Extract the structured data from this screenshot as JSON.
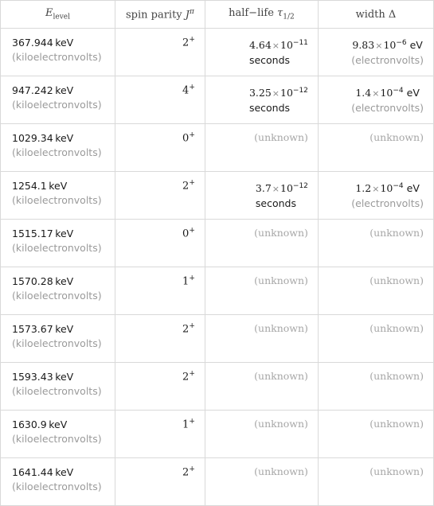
{
  "table": {
    "headers": {
      "energy": {
        "symbol": "E",
        "subscript": "level"
      },
      "spin": {
        "label": "spin parity ",
        "symbol": "J",
        "superscript": "π"
      },
      "halflife": {
        "label": "half−life ",
        "symbol": "τ",
        "subscript": "1/2"
      },
      "width": {
        "label": "width ",
        "symbol": "Δ"
      }
    },
    "rows": [
      {
        "energy": "367.944",
        "energy_unit": "keV",
        "energy_unit_long": "(kiloelectronvolts)",
        "spin": "2",
        "parity": "+",
        "halflife": {
          "known": true,
          "mantissa": "4.64",
          "times": "×",
          "base": "10",
          "exp": "−11",
          "unit": "seconds"
        },
        "width": {
          "known": true,
          "mantissa": "9.83",
          "times": "×",
          "base": "10",
          "exp": "−6",
          "unit": "eV",
          "unit_long": "(electronvolts)"
        }
      },
      {
        "energy": "947.242",
        "energy_unit": "keV",
        "energy_unit_long": "(kiloelectronvolts)",
        "spin": "4",
        "parity": "+",
        "halflife": {
          "known": true,
          "mantissa": "3.25",
          "times": "×",
          "base": "10",
          "exp": "−12",
          "unit": "seconds"
        },
        "width": {
          "known": true,
          "mantissa": "1.4",
          "times": "×",
          "base": "10",
          "exp": "−4",
          "unit": "eV",
          "unit_long": "(electronvolts)"
        }
      },
      {
        "energy": "1029.34",
        "energy_unit": "keV",
        "energy_unit_long": "(kiloelectronvolts)",
        "spin": "0",
        "parity": "+",
        "halflife": {
          "known": false,
          "text": "(unknown)"
        },
        "width": {
          "known": false,
          "text": "(unknown)"
        }
      },
      {
        "energy": "1254.1",
        "energy_unit": "keV",
        "energy_unit_long": "(kiloelectronvolts)",
        "spin": "2",
        "parity": "+",
        "halflife": {
          "known": true,
          "mantissa": "3.7",
          "times": "×",
          "base": "10",
          "exp": "−12",
          "unit": "seconds"
        },
        "width": {
          "known": true,
          "mantissa": "1.2",
          "times": "×",
          "base": "10",
          "exp": "−4",
          "unit": "eV",
          "unit_long": "(electronvolts)"
        }
      },
      {
        "energy": "1515.17",
        "energy_unit": "keV",
        "energy_unit_long": "(kiloelectronvolts)",
        "spin": "0",
        "parity": "+",
        "halflife": {
          "known": false,
          "text": "(unknown)"
        },
        "width": {
          "known": false,
          "text": "(unknown)"
        }
      },
      {
        "energy": "1570.28",
        "energy_unit": "keV",
        "energy_unit_long": "(kiloelectronvolts)",
        "spin": "1",
        "parity": "+",
        "halflife": {
          "known": false,
          "text": "(unknown)"
        },
        "width": {
          "known": false,
          "text": "(unknown)"
        }
      },
      {
        "energy": "1573.67",
        "energy_unit": "keV",
        "energy_unit_long": "(kiloelectronvolts)",
        "spin": "2",
        "parity": "+",
        "halflife": {
          "known": false,
          "text": "(unknown)"
        },
        "width": {
          "known": false,
          "text": "(unknown)"
        }
      },
      {
        "energy": "1593.43",
        "energy_unit": "keV",
        "energy_unit_long": "(kiloelectronvolts)",
        "spin": "2",
        "parity": "+",
        "halflife": {
          "known": false,
          "text": "(unknown)"
        },
        "width": {
          "known": false,
          "text": "(unknown)"
        }
      },
      {
        "energy": "1630.9",
        "energy_unit": "keV",
        "energy_unit_long": "(kiloelectronvolts)",
        "spin": "1",
        "parity": "+",
        "halflife": {
          "known": false,
          "text": "(unknown)"
        },
        "width": {
          "known": false,
          "text": "(unknown)"
        }
      },
      {
        "energy": "1641.44",
        "energy_unit": "keV",
        "energy_unit_long": "(kiloelectronvolts)",
        "spin": "2",
        "parity": "+",
        "halflife": {
          "known": false,
          "text": "(unknown)"
        },
        "width": {
          "known": false,
          "text": "(unknown)"
        }
      }
    ]
  }
}
